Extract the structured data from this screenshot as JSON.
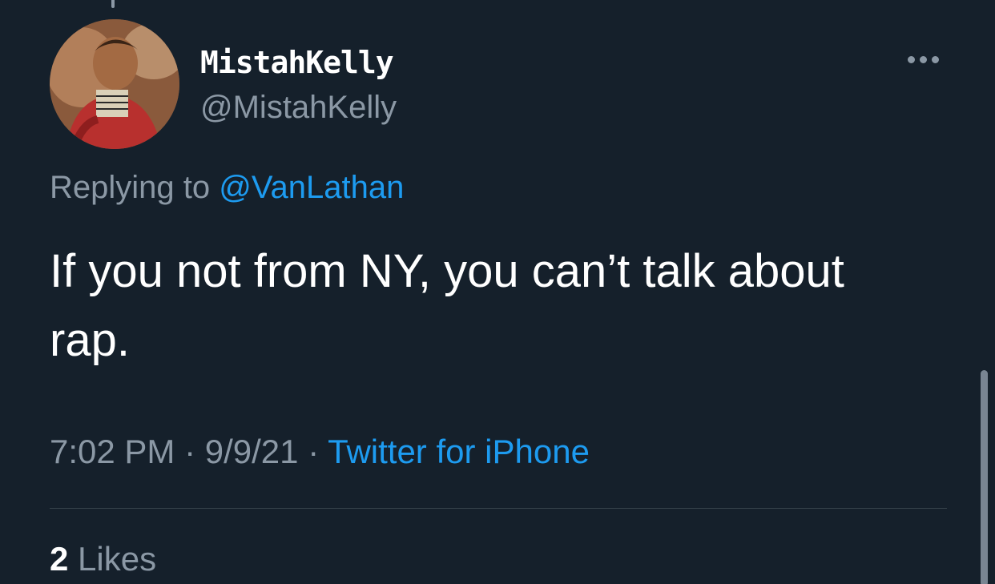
{
  "tweet": {
    "author": {
      "display_name": "MistahKelly",
      "handle": "@MistahKelly",
      "avatar_icon": "profile-photo"
    },
    "reply": {
      "prefix": "Replying to ",
      "mention": "@VanLathan"
    },
    "text": "If you not from NY, you can’t talk about rap.",
    "time": "7:02 PM",
    "separator": " · ",
    "date": "9/9/21",
    "source": "Twitter for iPhone",
    "likes": {
      "count": "2",
      "label": " Likes"
    }
  },
  "icons": {
    "more": "more-dots-icon"
  },
  "colors": {
    "background": "#15202b",
    "accent": "#1d9bf0",
    "secondary_text": "#8b98a5",
    "divider": "#38444d"
  }
}
